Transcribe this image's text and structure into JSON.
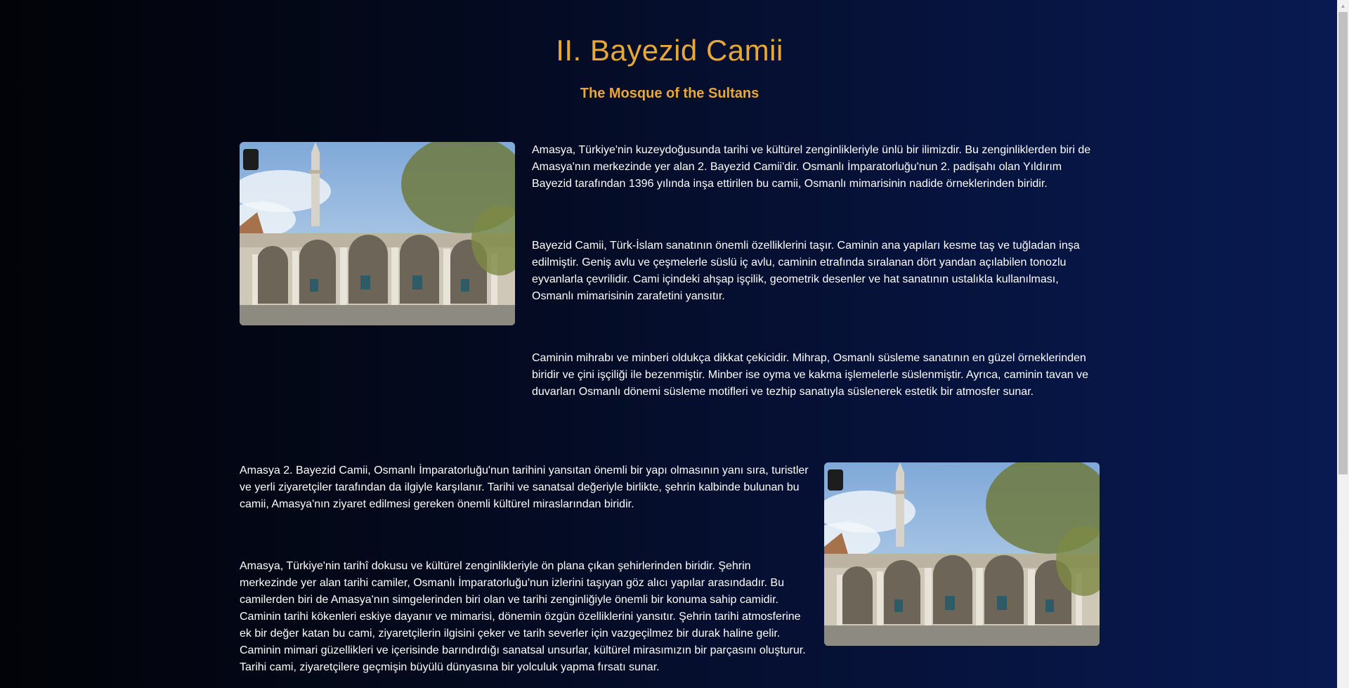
{
  "header": {
    "title": "II. Bayezid Camii",
    "subtitle": "The Mosque of the Sultans"
  },
  "sections": {
    "p1": "Amasya, Türkiye'nin kuzeydoğusunda tarihi ve kültürel zenginlikleriyle ünlü bir ilimizdir. Bu zenginliklerden biri de Amasya'nın merkezinde yer alan 2. Bayezid Camii'dir. Osmanlı İmparatorluğu'nun 2. padişahı olan Yıldırım Bayezid tarafından 1396 yılında inşa ettirilen bu camii, Osmanlı mimarisinin nadide örneklerinden biridir.",
    "p2": "Bayezid Camii, Türk-İslam sanatının önemli özelliklerini taşır. Caminin ana yapıları kesme taş ve tuğladan inşa edilmiştir. Geniş avlu ve çeşmelerle süslü iç avlu, caminin etrafında sıralanan dört yandan açılabilen tonozlu eyvanlarla çevrilidir. Cami içindeki ahşap işçilik, geometrik desenler ve hat sanatının ustalıkla kullanılması, Osmanlı mimarisinin zarafetini yansıtır.",
    "p3": "Caminin mihrabı ve minberi oldukça dikkat çekicidir. Mihrap, Osmanlı süsleme sanatının en güzel örneklerinden biridir ve çini işçiliği ile bezenmiştir. Minber ise oyma ve kakma işlemelerle süslenmiştir. Ayrıca, caminin tavan ve duvarları Osmanlı dönemi süsleme motifleri ve tezhip sanatıyla süslenerek estetik bir atmosfer sunar.",
    "p4": "Amasya 2. Bayezid Camii, Osmanlı İmparatorluğu'nun tarihini yansıtan önemli bir yapı olmasının yanı sıra, turistler ve yerli ziyaretçiler tarafından da ilgiyle karşılanır. Tarihi ve sanatsal değeriyle birlikte, şehrin kalbinde bulunan bu camii, Amasya'nın ziyaret edilmesi gereken önemli kültürel miraslarından biridir.",
    "p5": "Amasya, Türkiye'nin tarihî dokusu ve kültürel zenginlikleriyle ön plana çıkan şehirlerinden biridir. Şehrin merkezinde yer alan tarihi camiler, Osmanlı İmparatorluğu'nun izlerini taşıyan göz alıcı yapılar arasındadır. Bu camilerden biri de Amasya'nın simgelerinden biri olan ve tarihi zenginliğiyle önemli bir konuma sahip camidir. Caminin tarihi kökenleri eskiye dayanır ve mimarisi, dönemin özgün özelliklerini yansıtır. Şehrin tarihi atmosferine ek bir değer katan bu cami, ziyaretçilerin ilgisini çeker ve tarih severler için vazgeçilmez bir durak haline gelir. Caminin mimari güzellikleri ve içerisinde barındırdığı sanatsal unsurlar, kültürel mirasımızın bir parçasını oluşturur. Tarihi cami, ziyaretçilere geçmişin büyülü dünyasına bir yolculuk yapma fırsatı sunar."
  },
  "colors": {
    "accent": "#e8a838",
    "text": "#ffffff",
    "background_start": "#020308",
    "background_end": "#081a52"
  },
  "icons": {
    "scroll_up": "triangle-up"
  }
}
